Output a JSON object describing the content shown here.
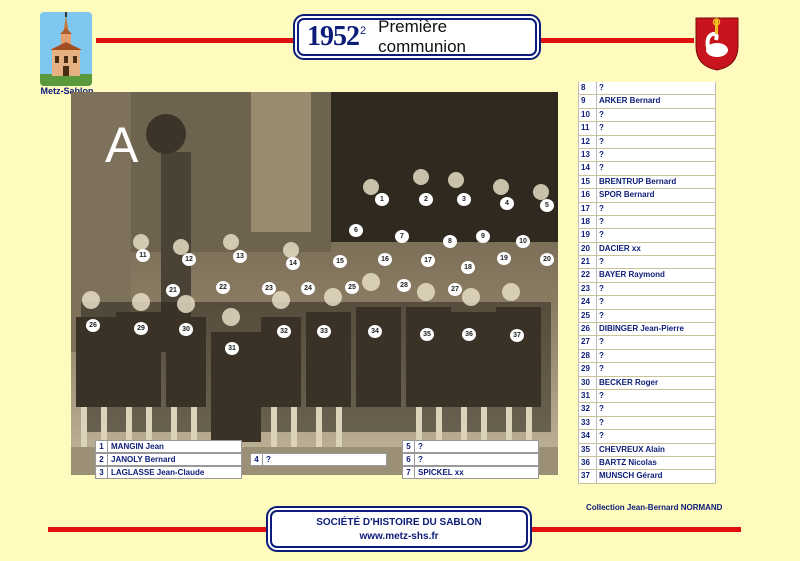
{
  "header": {
    "year": "1952",
    "year_sup": "2",
    "title": "Première communion",
    "logo_caption": "Metz-Sablon"
  },
  "photo": {
    "letter": "A",
    "markers": [
      "1",
      "2",
      "3",
      "4",
      "5",
      "6",
      "7",
      "8",
      "9",
      "10",
      "11",
      "12",
      "13",
      "14",
      "15",
      "16",
      "17",
      "18",
      "19",
      "20",
      "21",
      "22",
      "23",
      "24",
      "25",
      "26",
      "27",
      "28",
      "29",
      "30",
      "31",
      "32",
      "33",
      "34",
      "35",
      "36",
      "37"
    ]
  },
  "bottom_names": [
    {
      "n": "1",
      "v": "MANGIN Jean"
    },
    {
      "n": "2",
      "v": "JANOLY Bernard"
    },
    {
      "n": "3",
      "v": "LAGLASSE Jean-Claude"
    },
    {
      "n": "4",
      "v": "?"
    },
    {
      "n": "5",
      "v": "?"
    },
    {
      "n": "6",
      "v": "?"
    },
    {
      "n": "7",
      "v": "SPICKEL xx"
    }
  ],
  "right_names": [
    {
      "n": "8",
      "v": "?"
    },
    {
      "n": "9",
      "v": "ARKER Bernard"
    },
    {
      "n": "10",
      "v": "?"
    },
    {
      "n": "11",
      "v": "?"
    },
    {
      "n": "12",
      "v": "?"
    },
    {
      "n": "13",
      "v": "?"
    },
    {
      "n": "14",
      "v": "?"
    },
    {
      "n": "15",
      "v": "BRENTRUP Bernard"
    },
    {
      "n": "16",
      "v": "SPOR Bernard"
    },
    {
      "n": "17",
      "v": "?"
    },
    {
      "n": "18",
      "v": "?"
    },
    {
      "n": "19",
      "v": "?"
    },
    {
      "n": "20",
      "v": "DACIER xx"
    },
    {
      "n": "21",
      "v": "?"
    },
    {
      "n": "22",
      "v": "BAYER Raymond"
    },
    {
      "n": "23",
      "v": "?"
    },
    {
      "n": "24",
      "v": "?"
    },
    {
      "n": "25",
      "v": "?"
    },
    {
      "n": "26",
      "v": "DIBINGER Jean-Pierre"
    },
    {
      "n": "27",
      "v": "?"
    },
    {
      "n": "28",
      "v": "?"
    },
    {
      "n": "29",
      "v": "?"
    },
    {
      "n": "30",
      "v": "BECKER Roger"
    },
    {
      "n": "31",
      "v": "?"
    },
    {
      "n": "32",
      "v": "?"
    },
    {
      "n": "33",
      "v": "?"
    },
    {
      "n": "34",
      "v": "?"
    },
    {
      "n": "35",
      "v": "CHEVREUX Alain"
    },
    {
      "n": "36",
      "v": "BARTZ Nicolas"
    },
    {
      "n": "37",
      "v": "MUNSCH Gérard"
    }
  ],
  "collection": "Collection Jean-Bernard NORMAND",
  "footer": {
    "line1": "SOCIÉTÉ D'HISTOIRE DU SABLON",
    "line2": "www.metz-shs.fr"
  },
  "colors": {
    "accent_red": "#e01010",
    "navy": "#0c1c78",
    "background": "#fffbbf"
  }
}
